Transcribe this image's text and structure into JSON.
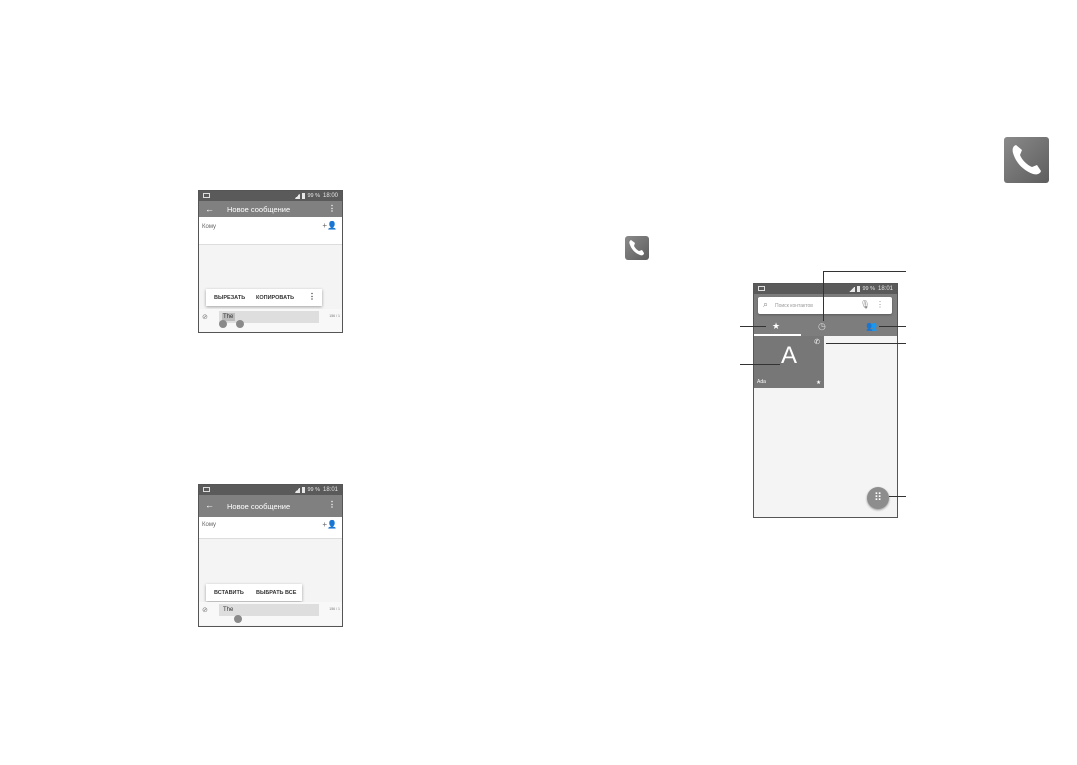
{
  "app_icons": {
    "phone_large": "phone-icon",
    "phone_small": "phone-icon"
  },
  "phone_cut": {
    "status_time": "18:00",
    "status_battery": "99 %",
    "toolbar_title": "Новое сообщение",
    "to_label": "Кому",
    "menu_cut": "ВЫРЕЗАТЬ",
    "menu_copy": "КОПИРОВАТЬ",
    "compose_text": "The",
    "counter": "156 / 1"
  },
  "phone_paste": {
    "status_time": "18:01",
    "status_battery": "99 %",
    "toolbar_title": "Новое сообщение",
    "to_label": "Кому",
    "menu_paste": "ВСТАВИТЬ",
    "menu_select_all": "ВЫБРАТЬ ВСЕ",
    "compose_text": "The",
    "counter": "156 / 1"
  },
  "phone_dialer": {
    "status_time": "18:01",
    "status_battery": "99 %",
    "search_placeholder": "Поиск контактов",
    "contact_letter": "A",
    "contact_name": "Ada"
  },
  "colors": {
    "toolbar": "#808080",
    "statusbar": "#5a5a5a",
    "tile": "#777777",
    "fab": "#8d8d8d"
  }
}
